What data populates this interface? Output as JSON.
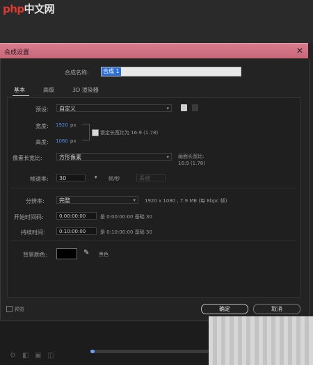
{
  "watermark": {
    "brand_prefix": "php",
    "brand_suffix": "中文网"
  },
  "dialog": {
    "title": "合成设置",
    "comp_name_label": "合成名称:",
    "comp_name_value": "合成 1",
    "tabs": [
      {
        "label": "基本"
      },
      {
        "label": "高级"
      },
      {
        "label": "3D 渲染器"
      }
    ],
    "preset": {
      "label": "预设:",
      "value": "自定义"
    },
    "width": {
      "label": "宽度:",
      "value": "1920",
      "unit": "px"
    },
    "height": {
      "label": "高度:",
      "value": "1080",
      "unit": "px"
    },
    "lock_aspect": {
      "label": "锁定长宽比为 16:9 (1.78)",
      "checked": true
    },
    "pixel_aspect": {
      "label": "像素长宽比:",
      "value": "方形像素",
      "frame_aspect_label": "画面长宽比:",
      "frame_aspect_value": "16:9 (1.78)"
    },
    "frame_rate": {
      "label": "帧速率:",
      "value": "30",
      "unit": "帧/秒",
      "drop_frame": "丢帧"
    },
    "resolution": {
      "label": "分辨率:",
      "value": "完整",
      "info": "1920 x 1080 , 7.9 MB (每 8bpc 帧)"
    },
    "start_timecode": {
      "label": "开始时间码:",
      "value": "0:00:00:00",
      "info": "是 0:00:00:00  基础 30"
    },
    "duration": {
      "label": "持续时间:",
      "value": "0:10:00:00",
      "info": "是 0:10:00:00  基础 30"
    },
    "background_color": {
      "label": "背景颜色:",
      "swatch": "#000000",
      "name": "黑色"
    },
    "preview_label": "预览",
    "ok_label": "确定",
    "cancel_label": "取消"
  },
  "colors": {
    "titlebar": "#d07488",
    "accent_blue": "#2b6fd6"
  }
}
